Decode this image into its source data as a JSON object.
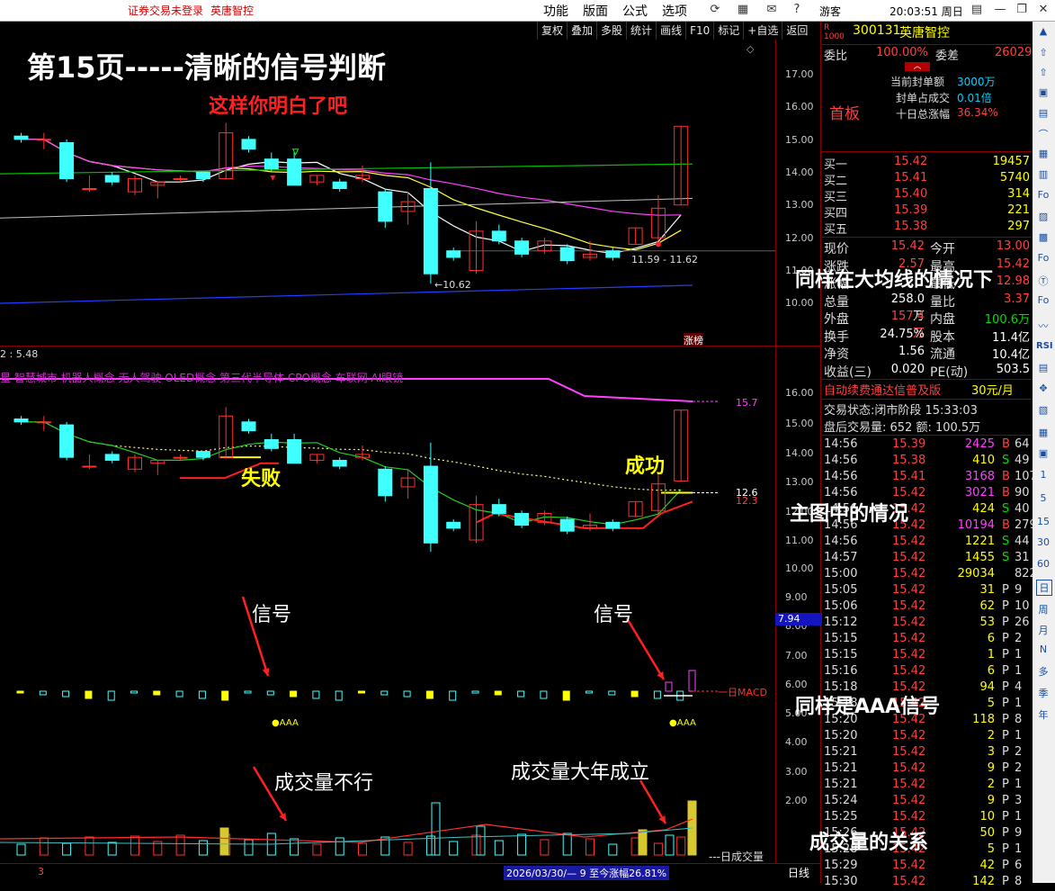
{
  "topbar": {
    "warning": "证券交易未登录",
    "stock_name": "英唐智控",
    "menus": [
      "功能",
      "版面",
      "公式",
      "选项"
    ],
    "user": "游客",
    "clock": "20:03:51 周日"
  },
  "toolbar": {
    "buttons": [
      "复权",
      "叠加",
      "多股",
      "统计",
      "画线",
      "F10",
      "标记",
      "+自选",
      "返回"
    ]
  },
  "main_chart": {
    "page_title": "第15页-----清晰的信号判断",
    "subtitle": "这样你明白了吧",
    "y_ticks": [
      "17.00",
      "16.00",
      "15.00",
      "14.00",
      "13.00",
      "12.00",
      "11.00",
      "10.00"
    ],
    "high_mark": "11.59 - 11.62",
    "low_mark": "10.62",
    "tag": "涨榜",
    "overlay_caption": "同样在大均线的情况下"
  },
  "sub_chart": {
    "header_value": "2 : 5.48",
    "concept_line": "星 智慧城市 机器人概念 无人驾驶 OLED概念 第三代半导体 CPO概念 车联网 AI眼镜",
    "y_ticks": [
      "16.00",
      "15.00",
      "14.00",
      "13.00",
      "12.00",
      "11.00",
      "10.00",
      "9.00",
      "8.00",
      "7.00",
      "6.00",
      "5.00",
      "4.00",
      "3.00",
      "2.00"
    ],
    "right_value_1": "15.7",
    "right_value_2": "12.6",
    "right_value_3": "12.3",
    "current_value": "7.94",
    "fail_label": "失败",
    "success_label": "成功",
    "main_caption": "主图中的情况",
    "signal_label_1": "信号",
    "signal_label_2": "信号",
    "macd_label": "一日MACD",
    "aaa_label_1": "●AAA",
    "aaa_label_2": "●AAA",
    "aaa_caption": "同样是AAA信号",
    "volume_bad": "成交量不行",
    "volume_good": "成交量大年成立",
    "volume_label": "---日成交量",
    "volume_caption": "成交量的关系"
  },
  "statusbar": {
    "left_num": "3",
    "range_text": "2026/03/30/— 9 至今涨幅26.81%",
    "period": "日线"
  },
  "quote_panel": {
    "code": "300131",
    "name": "英唐智控",
    "wei_bi_label": "委比",
    "wei_bi_value": "100.00%",
    "wei_cha_label": "委差",
    "wei_cha_value": "26029",
    "limit_label": "首板",
    "info": [
      {
        "label": "当前封单额",
        "value": "3000万"
      },
      {
        "label": "封单占成交",
        "value": "0.01倍"
      },
      {
        "label": "十日总涨幅",
        "value": "36.34%"
      }
    ],
    "bids": [
      {
        "label": "买一",
        "price": "15.42",
        "vol": "19457"
      },
      {
        "label": "买二",
        "price": "15.41",
        "vol": "5740"
      },
      {
        "label": "买三",
        "price": "15.40",
        "vol": "314"
      },
      {
        "label": "买四",
        "price": "15.39",
        "vol": "221"
      },
      {
        "label": "买五",
        "price": "15.38",
        "vol": "297"
      }
    ],
    "stats": [
      {
        "l1": "现价",
        "v1": "15.42",
        "l2": "今开",
        "v2": "13.00"
      },
      {
        "l1": "涨跌",
        "v1": "2.57",
        "l2": "最高",
        "v2": "15.42"
      },
      {
        "l1": "涨幅",
        "v1": "",
        "l2": "最低",
        "v2": "12.98"
      },
      {
        "l1": "总量",
        "v1": "258.0万",
        "l2": "量比",
        "v2": "3.37"
      },
      {
        "l1": "外盘",
        "v1": "157.4万",
        "l2": "内盘",
        "v2": "100.6万"
      },
      {
        "l1": "换手",
        "v1": "24.75%",
        "l2": "股本",
        "v2": "11.4亿"
      },
      {
        "l1": "净资",
        "v1": "1.56",
        "l2": "流通",
        "v2": "10.4亿"
      },
      {
        "l1": "收益(三)",
        "v1": "0.020",
        "l2": "PE(动)",
        "v2": "503.5"
      }
    ],
    "promo": "自动续费通达信普及版",
    "promo_price": "30元/月",
    "trade_state": "交易状态:闭市阶段 15:33:03",
    "after_hours": "盘后交易量: 652  额: 100.5万",
    "ticks": [
      {
        "t": "14:56",
        "p": "15.39",
        "v": "2425",
        "d": "B",
        "n": "64"
      },
      {
        "t": "14:56",
        "p": "15.38",
        "v": "410",
        "d": "S",
        "n": "49"
      },
      {
        "t": "14:56",
        "p": "15.41",
        "v": "3168",
        "d": "B",
        "n": "107"
      },
      {
        "t": "14:56",
        "p": "15.42",
        "v": "3021",
        "d": "B",
        "n": "90"
      },
      {
        "t": "14:56",
        "p": "15.42",
        "v": "424",
        "d": "S",
        "n": "40"
      },
      {
        "t": "14:56",
        "p": "15.42",
        "v": "10194",
        "d": "B",
        "n": "279"
      },
      {
        "t": "14:56",
        "p": "15.42",
        "v": "1221",
        "d": "S",
        "n": "44"
      },
      {
        "t": "14:57",
        "p": "15.42",
        "v": "1455",
        "d": "S",
        "n": "31"
      },
      {
        "t": "15:00",
        "p": "15.42",
        "v": "29034",
        "d": "",
        "n": "822"
      },
      {
        "t": "15:05",
        "p": "15.42",
        "v": "31",
        "d": "P",
        "n": "9"
      },
      {
        "t": "15:06",
        "p": "15.42",
        "v": "62",
        "d": "P",
        "n": "10"
      },
      {
        "t": "15:12",
        "p": "15.42",
        "v": "53",
        "d": "P",
        "n": "26"
      },
      {
        "t": "15:15",
        "p": "15.42",
        "v": "6",
        "d": "P",
        "n": "2"
      },
      {
        "t": "15:15",
        "p": "15.42",
        "v": "1",
        "d": "P",
        "n": "1"
      },
      {
        "t": "15:16",
        "p": "15.42",
        "v": "6",
        "d": "P",
        "n": "1"
      },
      {
        "t": "15:18",
        "p": "15.42",
        "v": "94",
        "d": "P",
        "n": "4"
      },
      {
        "t": "15:18",
        "p": "15.42",
        "v": "5",
        "d": "P",
        "n": "1"
      },
      {
        "t": "15:20",
        "p": "15.42",
        "v": "118",
        "d": "P",
        "n": "8"
      },
      {
        "t": "15:20",
        "p": "15.42",
        "v": "2",
        "d": "P",
        "n": "1"
      },
      {
        "t": "15:21",
        "p": "15.42",
        "v": "3",
        "d": "P",
        "n": "2"
      },
      {
        "t": "15:21",
        "p": "15.42",
        "v": "9",
        "d": "P",
        "n": "2"
      },
      {
        "t": "15:21",
        "p": "15.42",
        "v": "2",
        "d": "P",
        "n": "1"
      },
      {
        "t": "15:24",
        "p": "15.42",
        "v": "9",
        "d": "P",
        "n": "3"
      },
      {
        "t": "15:25",
        "p": "15.42",
        "v": "10",
        "d": "P",
        "n": "1"
      },
      {
        "t": "15:26",
        "p": "15.42",
        "v": "50",
        "d": "P",
        "n": "9"
      },
      {
        "t": "15:28",
        "p": "15.42",
        "v": "5",
        "d": "P",
        "n": "1"
      },
      {
        "t": "15:29",
        "p": "15.42",
        "v": "42",
        "d": "P",
        "n": "6"
      },
      {
        "t": "15:30",
        "p": "15.42",
        "v": "142",
        "d": "P",
        "n": "8"
      }
    ]
  },
  "edge_icons": [
    "1",
    "5",
    "15",
    "30",
    "60",
    "日",
    "周",
    "月",
    "N",
    "多",
    "季",
    "年"
  ],
  "edge_labels": [
    "RSI"
  ],
  "chart_data": {
    "type": "candlestick",
    "y_range": [
      10,
      17
    ],
    "candles": [
      {
        "o": 15.1,
        "c": 15.0,
        "h": 15.2,
        "l": 14.9
      },
      {
        "o": 15.0,
        "c": 15.0,
        "h": 15.2,
        "l": 14.7
      },
      {
        "o": 14.9,
        "c": 13.8,
        "h": 15.0,
        "l": 13.7
      },
      {
        "o": 13.5,
        "c": 13.5,
        "h": 13.9,
        "l": 13.4
      },
      {
        "o": 13.9,
        "c": 13.7,
        "h": 14.0,
        "l": 13.6
      },
      {
        "o": 13.4,
        "c": 13.8,
        "h": 13.9,
        "l": 13.3
      },
      {
        "o": 13.6,
        "c": 13.7,
        "h": 13.7,
        "l": 13.2
      },
      {
        "o": 13.8,
        "c": 13.8,
        "h": 13.9,
        "l": 13.7
      },
      {
        "o": 14.0,
        "c": 13.8,
        "h": 14.0,
        "l": 13.7
      },
      {
        "o": 13.8,
        "c": 15.2,
        "h": 15.5,
        "l": 13.8
      },
      {
        "o": 15.0,
        "c": 14.7,
        "h": 15.1,
        "l": 14.6
      },
      {
        "o": 14.4,
        "c": 14.1,
        "h": 14.6,
        "l": 14.0
      },
      {
        "o": 14.4,
        "c": 13.6,
        "h": 14.6,
        "l": 13.6
      },
      {
        "o": 13.7,
        "c": 13.9,
        "h": 13.9,
        "l": 13.6
      },
      {
        "o": 13.7,
        "c": 13.5,
        "h": 13.8,
        "l": 13.4
      },
      {
        "o": 13.8,
        "c": 13.9,
        "h": 14.2,
        "l": 13.7
      },
      {
        "o": 13.4,
        "c": 12.5,
        "h": 13.5,
        "l": 12.3
      },
      {
        "o": 12.8,
        "c": 13.1,
        "h": 13.4,
        "l": 12.4
      },
      {
        "o": 13.5,
        "c": 10.9,
        "h": 14.3,
        "l": 10.6
      },
      {
        "o": 11.6,
        "c": 11.4,
        "h": 11.7,
        "l": 11.3
      },
      {
        "o": 11.0,
        "c": 12.2,
        "h": 12.5,
        "l": 10.9
      },
      {
        "o": 12.2,
        "c": 11.9,
        "h": 12.4,
        "l": 11.8
      },
      {
        "o": 11.9,
        "c": 11.5,
        "h": 12.0,
        "l": 11.4
      },
      {
        "o": 11.6,
        "c": 11.9,
        "h": 12.0,
        "l": 11.5
      },
      {
        "o": 11.7,
        "c": 11.3,
        "h": 11.8,
        "l": 11.2
      },
      {
        "o": 11.4,
        "c": 11.5,
        "h": 11.9,
        "l": 11.3
      },
      {
        "o": 11.6,
        "c": 11.4,
        "h": 11.7,
        "l": 11.3
      },
      {
        "o": 11.8,
        "c": 12.3,
        "h": 12.3,
        "l": 11.8
      },
      {
        "o": 12.0,
        "c": 12.9,
        "h": 13.3,
        "l": 11.9
      },
      {
        "o": 13.0,
        "c": 15.4,
        "h": 15.4,
        "l": 13.0
      }
    ]
  }
}
